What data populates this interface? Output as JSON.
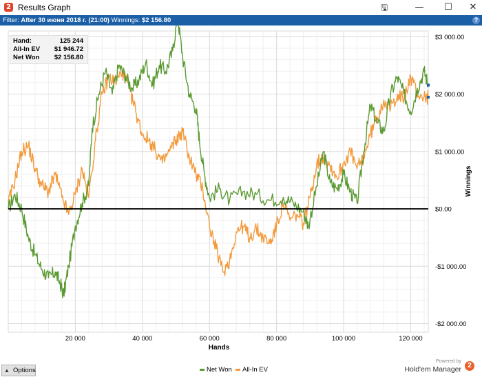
{
  "window": {
    "title": "Results Graph",
    "icon": "holdem-manager-logo-icon",
    "controls": [
      "save-graph-icon",
      "minimize-icon",
      "maximize-icon",
      "close-icon"
    ]
  },
  "filter_bar": {
    "prefix": "Filter:",
    "filter_value": "After 30 июня 2018 г. (21:00)",
    "winnings_label": "Winnings:",
    "winnings_value": "$2 156.80",
    "help_glyph": "?"
  },
  "stats": {
    "hands_label": "Hand:",
    "hands_value": "125 244",
    "allin_label": "All-In EV",
    "allin_value": "$1 946.72",
    "netwon_label": "Net Won",
    "netwon_value": "$2 156.80"
  },
  "colors": {
    "net_won": "#5b9a32",
    "all_in_ev": "#f39a3c",
    "filter_bar": "#1b5fa7",
    "zero_line": "#000000"
  },
  "chart_data": {
    "type": "line",
    "xlabel": "Hands",
    "ylabel": "Winnings",
    "xlim": [
      0,
      125244
    ],
    "ylim": [
      -2150,
      3100
    ],
    "x_ticks": [
      20000,
      40000,
      60000,
      80000,
      100000,
      120000
    ],
    "x_tick_labels": [
      "20 000",
      "40 000",
      "60 000",
      "80 000",
      "100 000",
      "120 000"
    ],
    "y_ticks": [
      3000,
      2000,
      1000,
      0,
      -1000,
      -2000
    ],
    "y_tick_labels": [
      "$3 000.00",
      "$2 000.00",
      "$1 000.00",
      "$0.00",
      "-$1 000.00",
      "-$2 000.00"
    ],
    "grid": true,
    "legend_position": "bottom",
    "series": [
      {
        "name": "Net Won",
        "color": "#5b9a32",
        "x": [
          0,
          2000,
          4000,
          6000,
          8000,
          10000,
          12000,
          14000,
          15500,
          16500,
          18000,
          20000,
          22000,
          24000,
          25000,
          27000,
          29000,
          31000,
          33000,
          35000,
          37000,
          39000,
          41000,
          43000,
          45000,
          47000,
          49000,
          50500,
          52000,
          54000,
          56000,
          57000,
          58500,
          60000,
          63000,
          66000,
          70000,
          74000,
          78000,
          82000,
          85000,
          88000,
          89500,
          92000,
          94000,
          96000,
          98000,
          100000,
          102000,
          104000,
          106000,
          108000,
          110000,
          112000,
          114000,
          116000,
          118000,
          120000,
          122000,
          124000,
          125244
        ],
        "values": [
          0,
          250,
          0,
          -500,
          -800,
          -1050,
          -1200,
          -1100,
          -1300,
          -1500,
          -1000,
          -300,
          100,
          400,
          1400,
          2000,
          2400,
          2000,
          2500,
          2300,
          2100,
          2250,
          2550,
          2150,
          2500,
          2400,
          2750,
          3350,
          2650,
          2000,
          1750,
          1200,
          600,
          200,
          350,
          150,
          300,
          250,
          150,
          200,
          100,
          -50,
          -300,
          400,
          1000,
          450,
          350,
          600,
          300,
          100,
          1000,
          1800,
          1500,
          1350,
          2000,
          2300,
          2000,
          1700,
          2100,
          2400,
          2156.8
        ]
      },
      {
        "name": "All-In EV",
        "color": "#f39a3c",
        "x": [
          0,
          2000,
          4000,
          6000,
          8000,
          10000,
          12000,
          14000,
          16000,
          18000,
          20000,
          22000,
          24000,
          26000,
          28000,
          30000,
          32000,
          34000,
          36000,
          38000,
          40000,
          42000,
          44000,
          46000,
          48000,
          50000,
          52000,
          54000,
          56000,
          58000,
          60000,
          62000,
          64000,
          66000,
          68000,
          70000,
          72000,
          74000,
          76000,
          78000,
          80000,
          82000,
          84000,
          86000,
          88000,
          90000,
          92000,
          94000,
          96000,
          98000,
          100000,
          102000,
          104000,
          106000,
          108000,
          110000,
          112000,
          114000,
          116000,
          118000,
          120000,
          122000,
          124000,
          125244
        ],
        "values": [
          100,
          500,
          1000,
          1100,
          700,
          400,
          300,
          600,
          200,
          -100,
          250,
          700,
          200,
          1200,
          2000,
          2300,
          2200,
          2400,
          2100,
          1700,
          1300,
          1200,
          1000,
          800,
          1000,
          1200,
          1350,
          900,
          600,
          350,
          -300,
          -700,
          -1100,
          -900,
          -400,
          -300,
          -500,
          -350,
          -500,
          -600,
          -300,
          100,
          -200,
          -100,
          -250,
          200,
          800,
          900,
          750,
          550,
          800,
          1000,
          700,
          900,
          1300,
          1600,
          1900,
          1750,
          2000,
          1900,
          2300,
          2000,
          1950,
          1946.72
        ]
      }
    ]
  },
  "bottom_bar": {
    "options_label": "Options",
    "legend_net_won": "Net Won",
    "legend_all_in_ev": "All-In EV",
    "powered_by": "Powered by",
    "brand_name": "Hold'em Manager",
    "brand_logo_glyph": "2"
  }
}
